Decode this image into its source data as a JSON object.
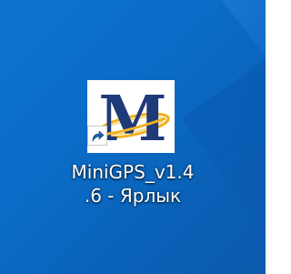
{
  "desktop": {
    "background_color": "#0a6cc6",
    "shortcut": {
      "icon_name": "minigps-logo-icon",
      "overlay_icon_name": "shortcut-arrow-icon",
      "logo_letter": "M",
      "label_line_1": "MiniGPS_v1.4",
      "label_line_2": ".6 - Ярлык",
      "colors": {
        "letter": "#1f3a78",
        "ring": "#f0b020",
        "tile": "#ffffff"
      }
    }
  }
}
